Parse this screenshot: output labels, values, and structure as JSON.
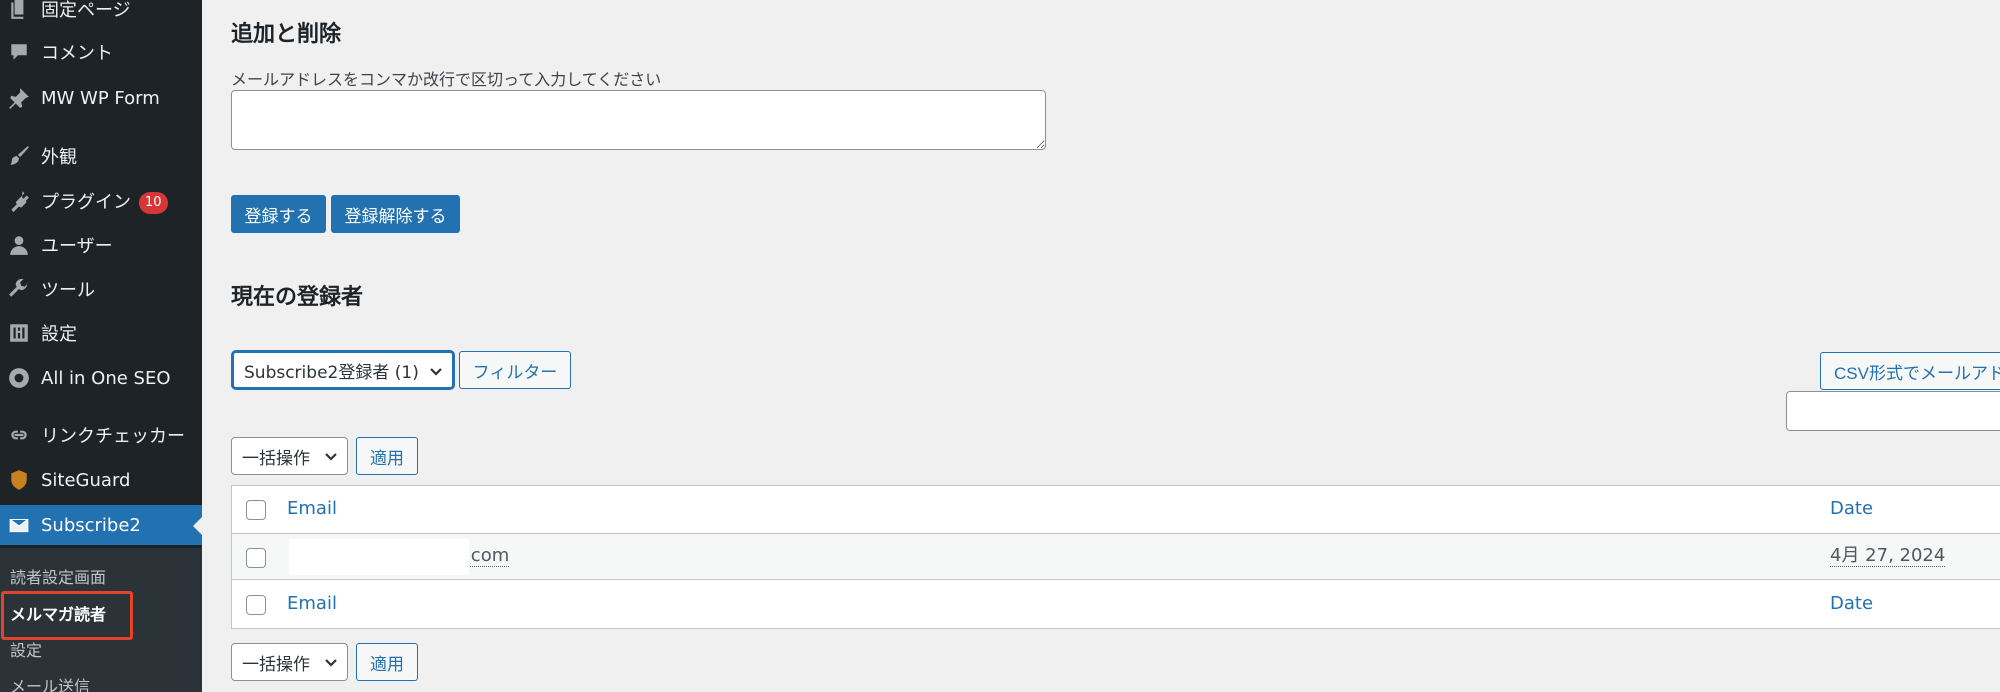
{
  "sidebar": {
    "items": [
      {
        "label": "固定ページ",
        "icon": "page-icon"
      },
      {
        "label": "コメント",
        "icon": "comment-icon"
      },
      {
        "label": "MW WP Form",
        "icon": "pin-icon"
      },
      {
        "label": "外観",
        "icon": "brush-icon"
      },
      {
        "label": "プラグイン",
        "icon": "plugin-icon",
        "badge": "10"
      },
      {
        "label": "ユーザー",
        "icon": "user-icon"
      },
      {
        "label": "ツール",
        "icon": "wrench-icon"
      },
      {
        "label": "設定",
        "icon": "settings-icon"
      },
      {
        "label": "All in One SEO",
        "icon": "seo-icon"
      },
      {
        "label": "リンクチェッカー",
        "icon": "link-checker-icon"
      },
      {
        "label": "SiteGuard",
        "icon": "shield-icon"
      },
      {
        "label": "Subscribe2",
        "icon": "envelope-icon",
        "active": true
      }
    ],
    "submenu": [
      "読者設定画面",
      "メルマガ読者",
      "設定",
      "メール送信"
    ],
    "submenu_current": "メルマガ読者"
  },
  "add_remove": {
    "heading": "追加と削除",
    "description": "メールアドレスをコンマか改行で区切って入力してください",
    "textarea_value": "",
    "subscribe_button": "登録する",
    "unsubscribe_button": "登録解除する"
  },
  "subscribers": {
    "heading": "現在の登録者",
    "filter_select": "Subscribe2登録者 (1)",
    "filter_button": "フィルター",
    "csv_button": "CSV形式でメールアド",
    "search_value": "",
    "bulk_top": "一括操作",
    "apply_top": "適用",
    "bulk_bottom": "一括操作",
    "apply_bottom": "適用",
    "table": {
      "columns": [
        "Email",
        "Date"
      ],
      "rows": [
        {
          "email": "e.com",
          "date": "4月 27, 2024"
        }
      ]
    }
  },
  "colors": {
    "sidebar_bg": "#1d2327",
    "accent": "#2271b1",
    "badge": "#d63638",
    "highlight": "#e0452b"
  }
}
